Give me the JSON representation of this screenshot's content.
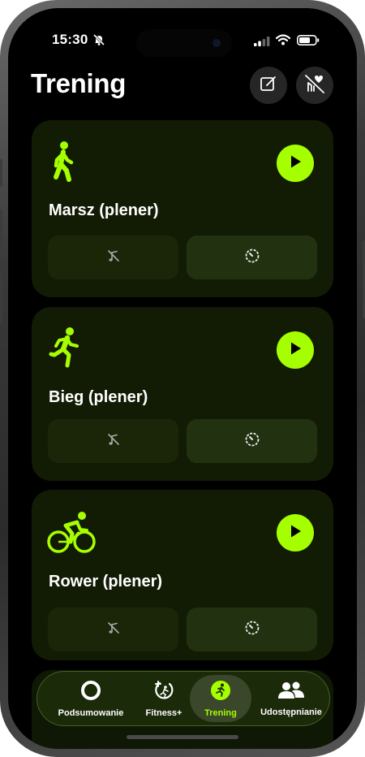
{
  "status_bar": {
    "time": "15:30",
    "icons": [
      "bell-slash-icon",
      "cellular-signal-icon",
      "wifi-icon",
      "battery-icon"
    ]
  },
  "header": {
    "title": "Trening",
    "edit_icon": "compose-icon",
    "health_icon": "heart-slash-icon"
  },
  "workouts": [
    {
      "label": "Marsz (plener)",
      "icon": "walking-figure-icon"
    },
    {
      "label": "Bieg (plener)",
      "icon": "running-figure-icon"
    },
    {
      "label": "Rower (plener)",
      "icon": "cycling-figure-icon"
    }
  ],
  "tabs": [
    {
      "label": "Podsumowanie",
      "icon": "activity-ring-icon",
      "active": false
    },
    {
      "label": "Fitness+",
      "icon": "fitness-plus-icon",
      "active": false
    },
    {
      "label": "Trening",
      "icon": "runner-circle-icon",
      "active": true
    },
    {
      "label": "Udostępnianie",
      "icon": "people-icon",
      "active": false
    }
  ],
  "colors": {
    "accent": "#a6ff00",
    "card_background": "#121c05",
    "screen_background": "#000000"
  }
}
